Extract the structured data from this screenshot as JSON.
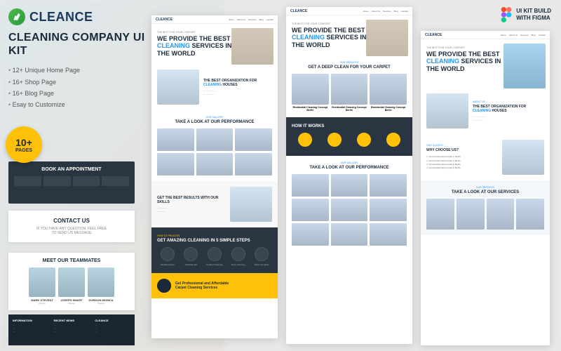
{
  "brand": "CLEANCE",
  "subtitle": "CLEANING COMPANY UI KIT",
  "features": [
    "12+ Unique Home Page",
    "16+ Shop Page",
    "16+ Blog Page",
    "Esay to Customize"
  ],
  "badge": {
    "num": "10+",
    "txt": "PAGES"
  },
  "figma": {
    "line1": "UI KIT BUILD",
    "line2": "WITH FIGMA"
  },
  "dark_card": {
    "title": "BOOK AN APPOINTMENT"
  },
  "contact": {
    "title": "CONTACT US",
    "line1": "IF YOU HAVE ANY QUESTION, FEEL FREE",
    "line2": "TO SEND US MESSAGE"
  },
  "team": {
    "title": "MEET OUR TEAMMATES",
    "members": [
      {
        "name": "MARK STEVENT",
        "role": "Cleaner"
      },
      {
        "name": "JOSEPH SMART",
        "role": "Cleaner"
      },
      {
        "name": "GORDON MONICA",
        "role": "Cleaner"
      }
    ]
  },
  "footer": {
    "cols": [
      {
        "h": "INFORMATION"
      },
      {
        "h": "RECENT NEWS"
      },
      {
        "h": "CLEANCE"
      }
    ]
  },
  "nav": [
    "Home",
    "About Us",
    "Services",
    "Blog",
    "Contact"
  ],
  "m1": {
    "hero_sm": "THE BEST FOR YOUR COMFORT",
    "hero": {
      "p1": "WE PROVIDE THE BEST",
      "hl": "CLEANING",
      "p2": " SERVICES IN",
      "p3": "THE WORLD"
    },
    "about": {
      "h1": "THE BEST ORGANIZATION FOR",
      "hl": "CLEANING",
      "h2": " HOUSES"
    },
    "perf": {
      "sm": "OUR GALLERY",
      "h": "TAKE A LOOK AT OUR PERFORMANCE"
    },
    "skills": {
      "h": "GET THE BEST RESULTS WITH OUR SKILLS"
    },
    "steps": {
      "sm": "HOW TO PROCESS",
      "h": "GET AMAZING CLEANING IN 5 SIMPLE STEPS",
      "items": [
        "Fast Response",
        "Schedule Set",
        "Conduct Cleaning",
        "Spick Cleaning",
        "Work Complete"
      ]
    },
    "yellow": {
      "l1": "Get Professional and Affordable",
      "l2": "Carpet Cleaning Services"
    }
  },
  "m2": {
    "hero_sm": "THE BEST FOR YOUR COMFORT",
    "hero": {
      "p1": "WE PROVIDE THE BEST",
      "hl": "CLEANING",
      "p2": " SERVICES IN",
      "p3": "THE WORLD"
    },
    "carpet": {
      "sm": "OUR SERVICES",
      "h": "GET A DEEP CLEAN FOR YOUR CARPET",
      "cards": [
        "Residential Cleaning Concept Berlin",
        "Residential Cleaning Concept Berlin",
        "Residential Cleaning Concept Berlin"
      ]
    },
    "how": {
      "h": "HOW IT WORKS"
    },
    "perf": {
      "sm": "OUR GALLERY",
      "h": "TAKE A LOOK AT OUR PERFORMANCE"
    }
  },
  "m3": {
    "hero_sm": "THE BEST FOR YOUR COMFORT",
    "hero": {
      "p1": "WE PROVIDE THE BEST",
      "hl": "CLEANING",
      "p2": " SERVICES IN",
      "p3": "THE WORLD"
    },
    "about": {
      "sm": "ABOUT US",
      "h1": "THE BEST ORGANIZATION FOR ",
      "hl": "CLEANING",
      "h2": " HOUSES"
    },
    "why": {
      "sm": "OUR CLIENTS",
      "h": "WHY CHOOSE US?",
      "items": [
        "Commercial carpet repair in Berlin",
        "Commercial carpet repair in Berlin",
        "Commercial carpet repair in Berlin",
        "Commercial carpet repair in Berlin"
      ]
    },
    "serv": {
      "sm": "OUR SERVICES",
      "h": "TAKE A LOOK AT OUR SERVICES"
    }
  }
}
